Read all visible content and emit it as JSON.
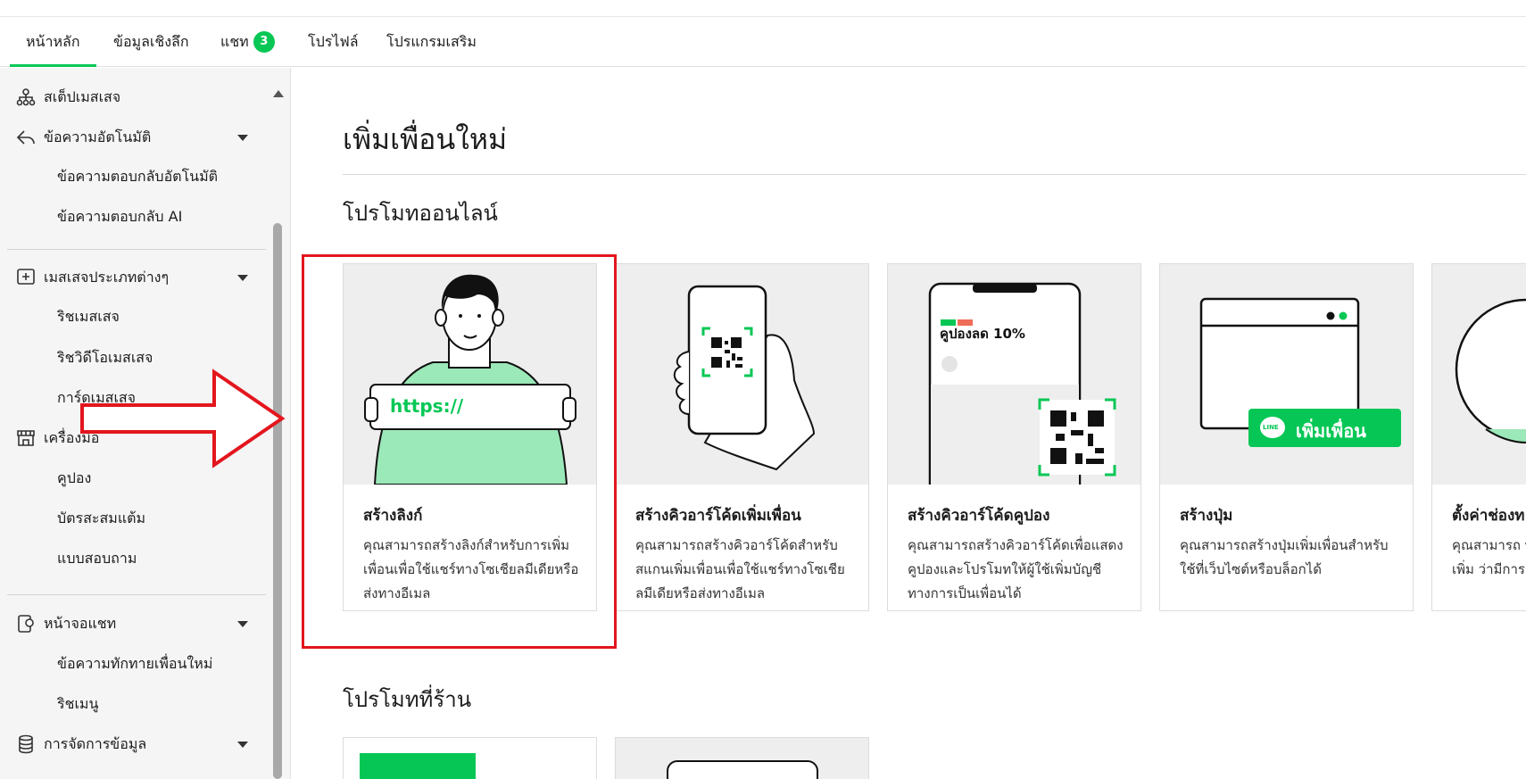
{
  "tabs": [
    {
      "label": "หน้าหลัก",
      "active": true
    },
    {
      "label": "ข้อมูลเชิงลึก"
    },
    {
      "label": "แชท",
      "badge": "3"
    },
    {
      "label": "โปรไฟล์"
    },
    {
      "label": "โปรแกรมเสริม"
    }
  ],
  "sidebar": {
    "step_message": "สเต็ปเมสเสจ",
    "auto_message": "ข้อความอัตโนมัติ",
    "auto_reply": "ข้อความตอบกลับอัตโนมัติ",
    "ai_reply": "ข้อความตอบกลับ AI",
    "message_types": "เมสเสจประเภทต่างๆ",
    "rich_message": "ริชเมสเสจ",
    "rich_video": "ริชวิดีโอเมสเสจ",
    "card_message": "การ์ดเมสเสจ",
    "tools": "เครื่องมือ",
    "coupon": "คูปอง",
    "reward_card": "บัตรสะสมแต้ม",
    "survey": "แบบสอบถาม",
    "chat_screen": "หน้าจอแชท",
    "greeting": "ข้อความทักทายเพื่อนใหม่",
    "rich_menu": "ริชเมนู",
    "data_management": "การจัดการข้อมูล"
  },
  "main": {
    "page_title": "เพิ่มเพื่อนใหม่",
    "online_section": "โปรโมทออนไลน์",
    "store_section": "โปรโมทที่ร้าน",
    "cards": [
      {
        "title": "สร้างลิงก์",
        "desc": "คุณสามารถสร้างลิงก์สำหรับการเพิ่มเพื่อนเพื่อใช้แชร์ทางโซเชียลมีเดียหรือส่งทางอีเมล",
        "illus_text": "https://"
      },
      {
        "title": "สร้างคิวอาร์โค้ดเพิ่มเพื่อน",
        "desc": "คุณสามารถสร้างคิวอาร์โค้ดสำหรับสแกนเพิ่มเพื่อนเพื่อใช้แชร์ทางโซเชียลมีเดียหรือส่งทางอีเมล"
      },
      {
        "title": "สร้างคิวอาร์โค้ดคูปอง",
        "desc": "คุณสามารถสร้างคิวอาร์โค้ดเพื่อแสดงคูปองและโปรโมทให้ผู้ใช้เพิ่มบัญชีทางการเป็นเพื่อนได้",
        "illus_text": "คูปองลด 10%"
      },
      {
        "title": "สร้างปุ่ม",
        "desc": "คุณสามารถสร้างปุ่มเพิ่มเพื่อนสำหรับใช้ที่เว็บไซต์หรือบล็อกได้",
        "illus_text": "เพิ่มเพื่อน",
        "logo_text": "LINE"
      },
      {
        "title": "ตั้งค่าช่องท",
        "desc": "คุณสามารถ ทางการเพิ่ม ว่ามีการเพิ่ม"
      }
    ]
  },
  "colors": {
    "accent": "#06c755",
    "highlight": "#e3161d",
    "illus_green": "#9be8b8"
  }
}
